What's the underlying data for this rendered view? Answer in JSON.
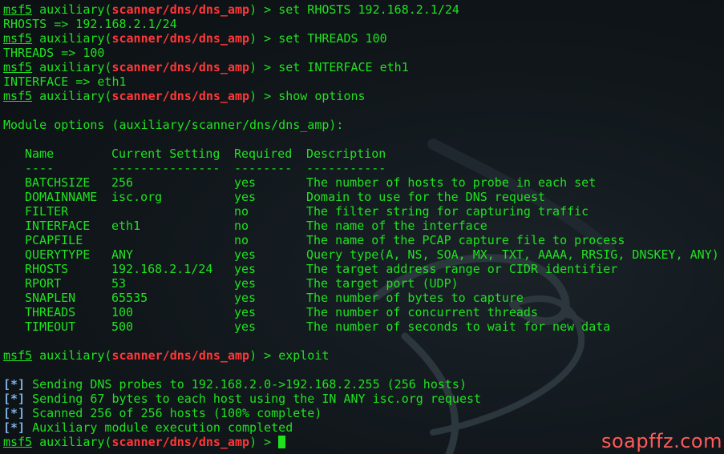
{
  "prompt": {
    "msf": "msf5",
    "module_prefix": " auxiliary(",
    "module_path": "scanner/dns/dns_amp",
    "module_suffix": ") > "
  },
  "commands": {
    "c1": "set RHOSTS 192.168.2.1/24",
    "c2": "set THREADS 100",
    "c3": "set INTERFACE eth1",
    "c4": "show options",
    "c5": "exploit"
  },
  "outputs": {
    "o1": "RHOSTS => 192.168.2.1/24",
    "o2": "THREADS => 100",
    "o3": "INTERFACE => eth1"
  },
  "module_options_heading": "Module options (auxiliary/scanner/dns/dns_amp):",
  "options_table": {
    "headers": {
      "name": "Name",
      "setting": "Current Setting",
      "required": "Required",
      "description": "Description"
    },
    "separators": {
      "name": "----",
      "setting": "---------------",
      "required": "--------",
      "description": "-----------"
    },
    "rows": [
      {
        "name": "BATCHSIZE",
        "setting": "256",
        "required": "yes",
        "description": "The number of hosts to probe in each set"
      },
      {
        "name": "DOMAINNAME",
        "setting": "isc.org",
        "required": "yes",
        "description": "Domain to use for the DNS request"
      },
      {
        "name": "FILTER",
        "setting": "",
        "required": "no",
        "description": "The filter string for capturing traffic"
      },
      {
        "name": "INTERFACE",
        "setting": "eth1",
        "required": "no",
        "description": "The name of the interface"
      },
      {
        "name": "PCAPFILE",
        "setting": "",
        "required": "no",
        "description": "The name of the PCAP capture file to process"
      },
      {
        "name": "QUERYTYPE",
        "setting": "ANY",
        "required": "yes",
        "description": "Query type(A, NS, SOA, MX, TXT, AAAA, RRSIG, DNSKEY, ANY)"
      },
      {
        "name": "RHOSTS",
        "setting": "192.168.2.1/24",
        "required": "yes",
        "description": "The target address range or CIDR identifier"
      },
      {
        "name": "RPORT",
        "setting": "53",
        "required": "yes",
        "description": "The target port (UDP)"
      },
      {
        "name": "SNAPLEN",
        "setting": "65535",
        "required": "yes",
        "description": "The number of bytes to capture"
      },
      {
        "name": "THREADS",
        "setting": "100",
        "required": "yes",
        "description": "The number of concurrent threads"
      },
      {
        "name": "TIMEOUT",
        "setting": "500",
        "required": "yes",
        "description": "The number of seconds to wait for new data"
      }
    ]
  },
  "status_marker": {
    "open": "[",
    "star": "*",
    "close": "]"
  },
  "status_lines": [
    "Sending DNS probes to 192.168.2.0->192.168.2.255 (256 hosts)",
    "Sending 67 bytes to each host using the IN ANY isc.org request",
    "Scanned 256 of 256 hosts (100% complete)",
    "Auxiliary module execution completed"
  ],
  "watermark": "soapffz.com",
  "colors": {
    "background": "#10161a",
    "text_green": "#1fe21f",
    "module_red": "#ff3838",
    "status_blue": "#7fb2e6",
    "watermark_red": "#ff5a5a"
  }
}
